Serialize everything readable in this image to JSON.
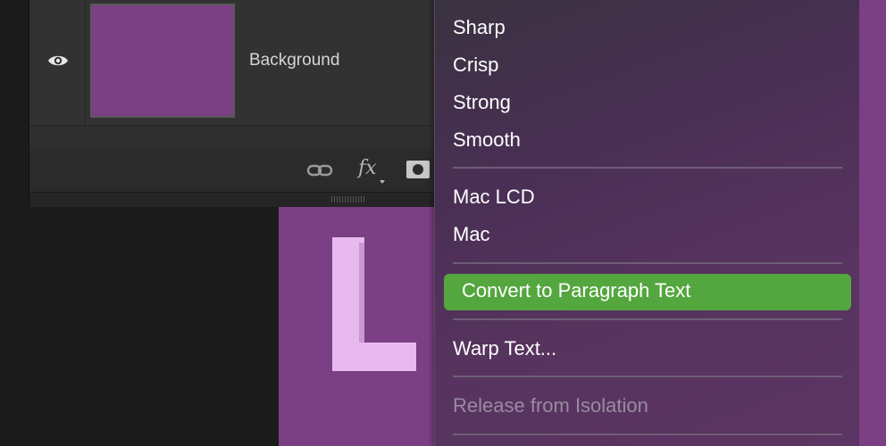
{
  "layers_panel": {
    "layer": {
      "name": "Background"
    },
    "toolbar": {
      "link_icon": "link-icon",
      "fx_label": "fx",
      "mask_icon": "layer-mask-icon"
    },
    "colors": {
      "thumbnail": "#7b3f84",
      "panel_bg": "#2b2b2b"
    }
  },
  "canvas": {
    "letter": "L",
    "colors": {
      "background": "#7b3f84",
      "letter": "#e8b9ef"
    }
  },
  "context_menu": {
    "items": [
      {
        "label": "Sharp"
      },
      {
        "label": "Crisp"
      },
      {
        "label": "Strong"
      },
      {
        "label": "Smooth"
      },
      {
        "label": "Mac LCD"
      },
      {
        "label": "Mac"
      },
      {
        "label": "Convert to Paragraph Text",
        "highlighted": true
      },
      {
        "label": "Warp Text..."
      },
      {
        "label": "Release from Isolation",
        "disabled": true
      }
    ],
    "colors": {
      "highlight": "#54a63f",
      "text": "#ffffff",
      "disabled_text": "#9a8aa2"
    }
  }
}
